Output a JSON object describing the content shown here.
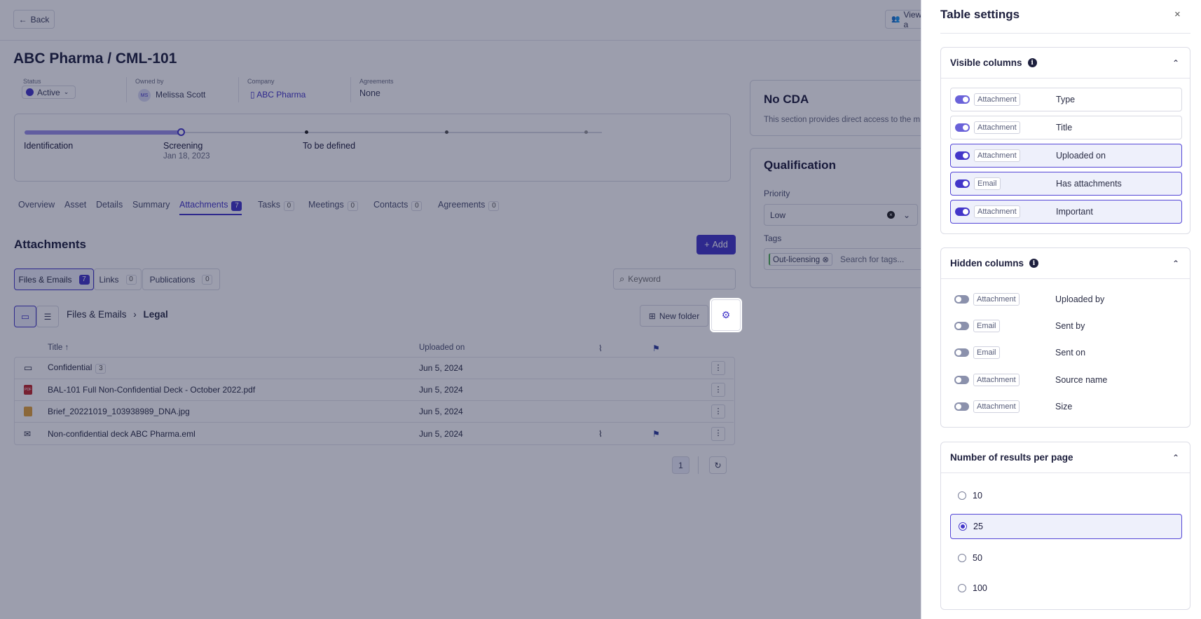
{
  "header": {
    "back_label": "Back",
    "view_label": "View a",
    "title": "ABC Pharma / CML-101"
  },
  "meta": {
    "status_label": "Status",
    "status_value": "Active",
    "owner_label": "Owned by",
    "owner_initials": "MS",
    "owner_name": "Melissa Scott",
    "company_label": "Company",
    "company_value": "ABC Pharma",
    "agreements_label": "Agreements",
    "agreements_value": "None"
  },
  "stages": [
    {
      "name": "Identification",
      "date": ""
    },
    {
      "name": "Screening",
      "date": "Jan 18, 2023"
    },
    {
      "name": "To be defined",
      "date": ""
    }
  ],
  "tabs": [
    {
      "label": "Overview",
      "count": ""
    },
    {
      "label": "Asset",
      "count": ""
    },
    {
      "label": "Details",
      "count": ""
    },
    {
      "label": "Summary",
      "count": ""
    },
    {
      "label": "Attachments",
      "count": "7"
    },
    {
      "label": "Tasks",
      "count": "0"
    },
    {
      "label": "Meetings",
      "count": "0"
    },
    {
      "label": "Contacts",
      "count": "0"
    },
    {
      "label": "Agreements",
      "count": "0"
    }
  ],
  "attachments": {
    "title": "Attachments",
    "add_label": "Add",
    "subtabs": [
      {
        "label": "Files & Emails",
        "count": "7"
      },
      {
        "label": "Links",
        "count": "0"
      },
      {
        "label": "Publications",
        "count": "0"
      }
    ],
    "keyword_placeholder": "Keyword",
    "breadcrumb_root": "Files & Emails",
    "breadcrumb_current": "Legal",
    "new_folder_label": "New folder",
    "columns": {
      "title": "Title",
      "uploaded": "Uploaded on"
    },
    "rows": [
      {
        "name": "Confidential",
        "count": "3",
        "date": "Jun 5, 2024",
        "icon": "folder-icon"
      },
      {
        "name": "BAL-101 Full Non-Confidential Deck - October 2022.pdf",
        "count": "",
        "date": "Jun 5, 2024",
        "icon": "pdf-icon"
      },
      {
        "name": "Brief_20221019_103938989_DNA.jpg",
        "count": "",
        "date": "Jun 5, 2024",
        "icon": "image-icon"
      },
      {
        "name": "Non-confidential deck ABC Pharma.eml",
        "count": "",
        "date": "Jun 5, 2024",
        "icon": "email-icon"
      }
    ],
    "page": "1"
  },
  "right_cards": {
    "cda_title": "No CDA",
    "cda_text": "This section provides direct access to the m",
    "qual_title": "Qualification",
    "priority_label": "Priority",
    "priority_value": "Low",
    "tags_label": "Tags",
    "tag": "Out-licensing",
    "tags_placeholder": "Search for tags..."
  },
  "panel": {
    "title": "Table settings",
    "visible_title": "Visible columns",
    "visible": [
      {
        "pill": "Attachment",
        "name": "Type"
      },
      {
        "pill": "Attachment",
        "name": "Title"
      },
      {
        "pill": "Attachment",
        "name": "Uploaded on"
      },
      {
        "pill": "Email",
        "name": "Has attachments"
      },
      {
        "pill": "Attachment",
        "name": "Important"
      }
    ],
    "hidden_title": "Hidden columns",
    "hidden": [
      {
        "pill": "Attachment",
        "name": "Uploaded by"
      },
      {
        "pill": "Email",
        "name": "Sent by"
      },
      {
        "pill": "Email",
        "name": "Sent on"
      },
      {
        "pill": "Attachment",
        "name": "Source name"
      },
      {
        "pill": "Attachment",
        "name": "Size"
      }
    ],
    "results_title": "Number of results per page",
    "results_options": [
      "10",
      "25",
      "50",
      "100"
    ],
    "results_selected": "25"
  },
  "colors": {
    "accent": "#4336c9",
    "overlay": "rgba(20,24,60,0.42)"
  }
}
